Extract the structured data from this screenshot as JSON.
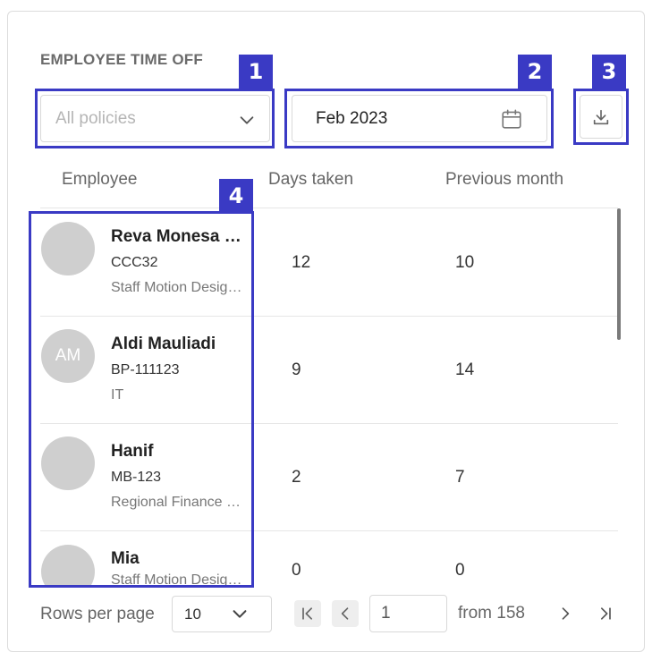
{
  "section": {
    "title": "EMPLOYEE TIME OFF"
  },
  "filters": {
    "policy_placeholder": "All policies",
    "date_value": "Feb 2023"
  },
  "table": {
    "columns": [
      "Employee",
      "Days taken",
      "Previous month"
    ],
    "rows": [
      {
        "initials": "",
        "name": "Reva Monesa Putri",
        "code": "CCC32",
        "dept": "Staff Motion Designer",
        "days_taken": "12",
        "previous_month": "10"
      },
      {
        "initials": "AM",
        "name": "Aldi Mauliadi",
        "code": "BP-111123",
        "dept": "IT",
        "days_taken": "9",
        "previous_month": "14"
      },
      {
        "initials": "",
        "name": "Hanif",
        "code": "MB-123",
        "dept": "Regional Finance Manager",
        "days_taken": "2",
        "previous_month": "7"
      },
      {
        "initials": "",
        "name": "Mia",
        "code": "",
        "dept": "Staff Motion Designer",
        "days_taken": "0",
        "previous_month": "0"
      }
    ]
  },
  "pagination": {
    "rows_per_page_label": "Rows per page",
    "rows_per_page_value": "10",
    "current_page": "1",
    "total_label": "from 158"
  },
  "annotations": {
    "labels": [
      "1",
      "2",
      "3",
      "4"
    ],
    "color": "#3a3ac4"
  },
  "icons": {
    "policy_dropdown": "chevron-down-icon",
    "date_picker": "calendar-icon",
    "export": "download-icon",
    "first_page": "first-page-icon",
    "prev_page": "chevron-left-icon",
    "next_page": "chevron-right-icon",
    "last_page": "last-page-icon"
  }
}
